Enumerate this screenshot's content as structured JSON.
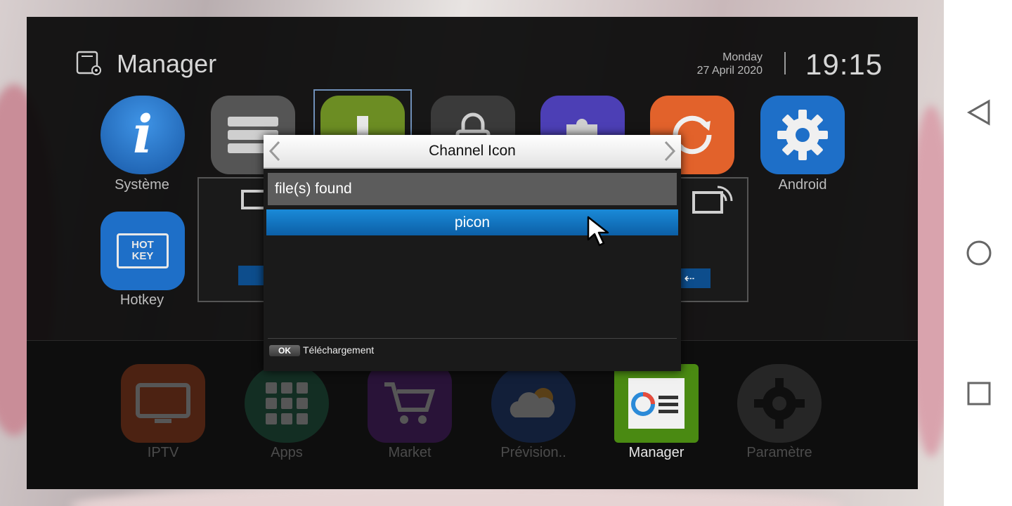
{
  "header": {
    "title": "Manager",
    "day": "Monday",
    "date": "27 April 2020",
    "time": "19:15"
  },
  "apps_top": [
    {
      "label": "Système",
      "icon": "info-icon",
      "color": "#1e6fc8"
    },
    {
      "label": "",
      "icon": "storage-icon",
      "color": "#5b5b5b"
    },
    {
      "label": "",
      "icon": "download-icon",
      "color": "#6c8d23"
    },
    {
      "label": "",
      "icon": "lock-icon",
      "color": "#3b3b3b"
    },
    {
      "label": "",
      "icon": "puzzle-icon",
      "color": "#4c3fb5"
    },
    {
      "label": "",
      "icon": "refresh-icon",
      "color": "#e2622b"
    },
    {
      "label": "Android",
      "icon": "gear-icon",
      "color": "#1e6fc8"
    }
  ],
  "apps_second": [
    {
      "label": "Hotkey",
      "icon": "hotkey-icon",
      "icon_text": "HOT KEY",
      "color": "#1e6fc8"
    }
  ],
  "dock": [
    {
      "label": "IPTV",
      "icon": "tv-icon",
      "color": "#c0471a"
    },
    {
      "label": "Apps",
      "icon": "grid-icon",
      "color": "#1f6b4a"
    },
    {
      "label": "Market",
      "icon": "cart-icon",
      "color": "#5c1e86"
    },
    {
      "label": "Prévision..",
      "icon": "weather-icon",
      "color": "#1a3f8a"
    },
    {
      "label": "Manager",
      "icon": "manager-icon",
      "color": "#4a8a12"
    },
    {
      "label": "Paramètre",
      "icon": "settings-icon",
      "color": "#555555"
    }
  ],
  "dialog": {
    "title": "Channel Icon",
    "status": "file(s) found",
    "items": [
      "picon"
    ],
    "footer_key": "OK",
    "footer_action": "Téléchargement"
  },
  "colors": {
    "selection": "#0c75c8",
    "accent_blue": "#1e6fc8"
  }
}
